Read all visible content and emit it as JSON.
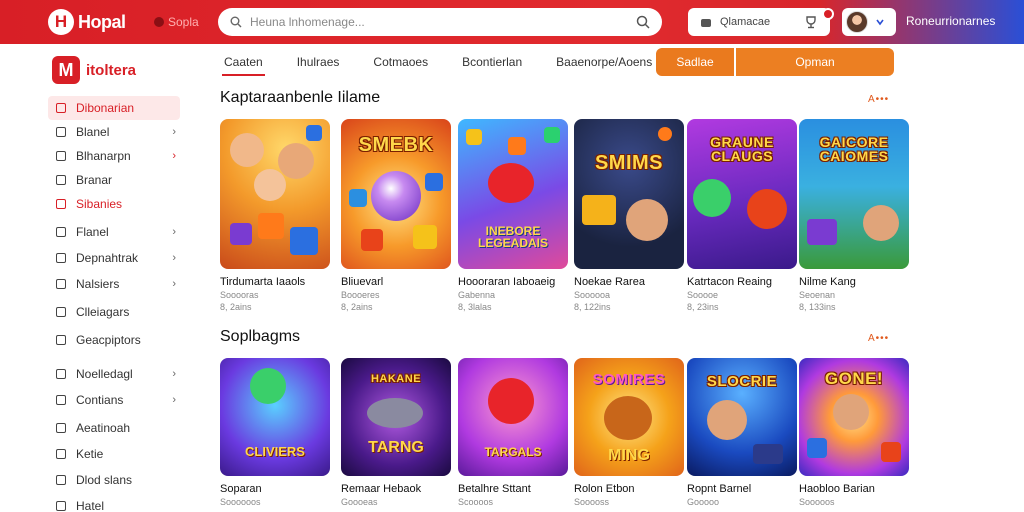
{
  "header": {
    "brand": "Hopal",
    "sub_label": "Sopla",
    "search_placeholder": "Heuna lnhomenage...",
    "actions_label": "Qlamacae",
    "user_name": "Roneurrionarnes"
  },
  "sidebar": {
    "brand": "itoltera",
    "items": [
      {
        "label": "Dibonarian",
        "chevron": ""
      },
      {
        "label": "Blanel",
        "chevron": "›"
      },
      {
        "label": "Blhanarpn",
        "chevron": "›"
      },
      {
        "label": "Branar",
        "chevron": ""
      },
      {
        "label": "Sibanies",
        "chevron": ""
      },
      {
        "label": "Flanel",
        "chevron": "›"
      },
      {
        "label": "Depnahtrak",
        "chevron": "›"
      },
      {
        "label": "Nalsiers",
        "chevron": "›"
      },
      {
        "label": "Clleiagars",
        "chevron": ""
      },
      {
        "label": "Geacpiptors",
        "chevron": ""
      },
      {
        "label": "Noelledagl",
        "chevron": "›"
      },
      {
        "label": "Contians",
        "chevron": "›"
      },
      {
        "label": "Aeatinoah",
        "chevron": ""
      },
      {
        "label": "Ketie",
        "chevron": ""
      },
      {
        "label": "Dlod slans",
        "chevron": ""
      },
      {
        "label": "Hatel",
        "chevron": ""
      }
    ]
  },
  "tabs": [
    "Caaten",
    "Ihulraes",
    "Cotmaoes",
    "Bcontierlan",
    "Baaenorpe/Aoens"
  ],
  "pills": {
    "left": "Sadlae",
    "right": "Opman"
  },
  "sections": [
    {
      "title": "Kaptaraanbenle Iilame",
      "more": "A•••",
      "games": [
        {
          "name": "Tirdumarta Iaaols",
          "meta1": "Sooooras",
          "meta2": "8, 2ains",
          "art_title": "",
          "art_sub": ""
        },
        {
          "name": "Bliuevarl",
          "meta1": "Boooeres",
          "meta2": "8, 2ains",
          "art_title": "SMEBK",
          "art_sub": ""
        },
        {
          "name": "Hoooraran Iaboaeig",
          "meta1": "Gabenna",
          "meta2": "8, 3lalas",
          "art_title": "",
          "art_sub": "INEBORE LEGEADAIS"
        },
        {
          "name": "Noekae Rarea",
          "meta1": "Soooooa",
          "meta2": "8, 122ins",
          "art_title": "SMIMS",
          "art_sub": ""
        },
        {
          "name": "Katrtacon Reaing",
          "meta1": "Sooooe",
          "meta2": "8, 23ins",
          "art_title": "GRAUNE CLAUGS",
          "art_sub": ""
        },
        {
          "name": "Nilme Kang",
          "meta1": "Seoenan",
          "meta2": "8, 133ins",
          "art_title": "GAICORE CAIOMES",
          "art_sub": ""
        }
      ]
    },
    {
      "title": "Soplbagms",
      "more": "A•••",
      "games": [
        {
          "name": "Soparan",
          "meta1": "Soooooos",
          "meta2": "",
          "art_title": "",
          "art_sub": "CLIVIERS"
        },
        {
          "name": "Remaar Hebaok",
          "meta1": "Goooeas",
          "meta2": "",
          "art_title": "HAKANE",
          "art_sub": "TARNG"
        },
        {
          "name": "Betalhre Sttant",
          "meta1": "Scoooos",
          "meta2": "",
          "art_title": "",
          "art_sub": "TARGALS"
        },
        {
          "name": "Rolon Etbon",
          "meta1": "Sooooss",
          "meta2": "",
          "art_title": "SOMIRES",
          "art_sub": "MING"
        },
        {
          "name": "Ropnt Barnel",
          "meta1": "Gooooo",
          "meta2": "",
          "art_title": "SLOCRIE",
          "art_sub": ""
        },
        {
          "name": "Haobloo Barian",
          "meta1": "Sooooos",
          "meta2": "",
          "art_title": "GONE!",
          "art_sub": ""
        }
      ]
    }
  ],
  "theme": {
    "brand_red": "#d81f26",
    "accent_orange": "#ea7a1e",
    "header_blue": "#2a4fd6"
  }
}
